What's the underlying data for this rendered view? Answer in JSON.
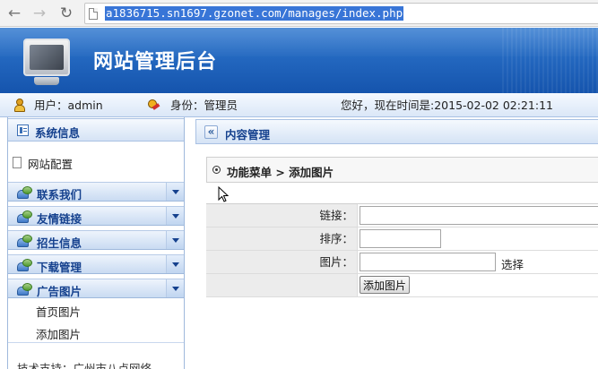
{
  "browser": {
    "url": "a1836715.sn1697.gzonet.com/manages/index.php"
  },
  "header": {
    "title": "网站管理后台"
  },
  "infobar": {
    "user": "用户：admin",
    "role": "身份：管理员",
    "greeting": "您好，现在时间是:2015-02-02 02:21:11"
  },
  "sidebar": {
    "system_info": "系统信息",
    "site_config": "网站配置",
    "groups": [
      "联系我们",
      "友情链接",
      "招生信息",
      "下载管理",
      "广告图片"
    ],
    "ad_items": [
      "首页图片",
      "添加图片"
    ],
    "support": "技术支持：广州市八点网络"
  },
  "content": {
    "title": "内容管理",
    "breadcrumb": "功能菜单 > 添加图片",
    "form": {
      "link_label": "链接：",
      "order_label": "排序：",
      "image_label": "图片：",
      "browse_label": "选择",
      "submit_label": "添加图片"
    }
  }
}
